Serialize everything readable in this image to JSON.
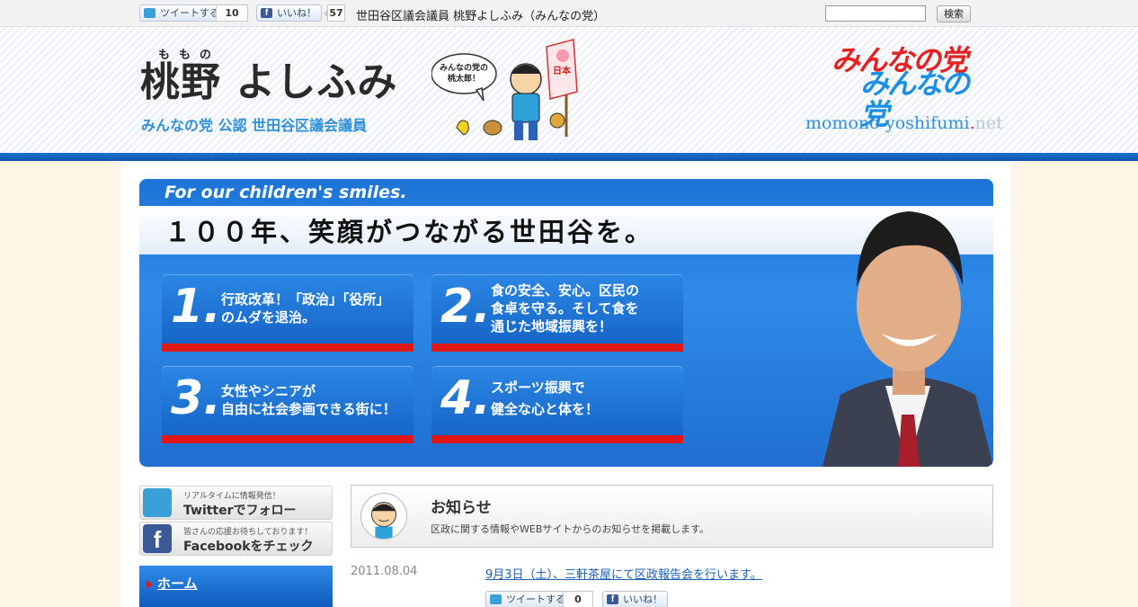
{
  "topbar": {
    "tweet_label": "ツイートする",
    "tweet_count": "10",
    "like_label": "いいね！",
    "like_count": "57",
    "page_title": "世田谷区議会議員 桃野よしふみ（みんなの党）",
    "search_placeholder": "",
    "search_button": "検索"
  },
  "header": {
    "ruby": "ももの",
    "name": "桃野 よしふみ",
    "subtitle": "みんなの党 公認 世田谷区議会議員",
    "mascot_bubble": "みんなの党の桃太郎！",
    "mascot_flag": "日本一",
    "party_logo_1": "みんなの党",
    "party_logo_2": "みんなの党",
    "domain_main": "momono-yoshifumi",
    "domain_dot": ".",
    "domain_tld": "net"
  },
  "banner": {
    "tagline": "For our children's smiles.",
    "headline": "１００年、笑顔がつながる世田谷を。",
    "policies": [
      {
        "num": "1.",
        "line1": "行政改革！「政治」「役所」",
        "line2": "のムダを退治。",
        "line3": ""
      },
      {
        "num": "2.",
        "line1": "食の安全、安心。区民の",
        "line2": "食卓を守る。そして食を",
        "line3": "通じた地域振興を！"
      },
      {
        "num": "3.",
        "line1": "女性やシニアが",
        "line2": "自由に社会参画できる街に！",
        "line3": ""
      },
      {
        "num": "4.",
        "line1": "スポーツ振興で",
        "line2": "健全な心と体を！",
        "line3": ""
      }
    ]
  },
  "sidebar": {
    "twitter_small": "リアルタイムに情報発信！",
    "twitter_big": "Twitterでフォロー",
    "facebook_small": "皆さんの応援お待ちしております！",
    "facebook_big": "Facebookをチェック",
    "nav_home": "ホーム"
  },
  "notice": {
    "title": "お知らせ",
    "description": "区政に関する情報やWEBサイトからのお知らせを掲載します。"
  },
  "posts": [
    {
      "date": "2011.08.04",
      "title": "9月3日（土）、三軒茶屋にて区政報告会を行います。",
      "tweet_label": "ツイートする",
      "tweet_count": "0",
      "like_label": "いいね！"
    }
  ],
  "colors": {
    "accent_blue": "#1d74d6",
    "accent_red": "#e01818",
    "party_red": "#e62020",
    "party_blue": "#1a8fe6"
  }
}
